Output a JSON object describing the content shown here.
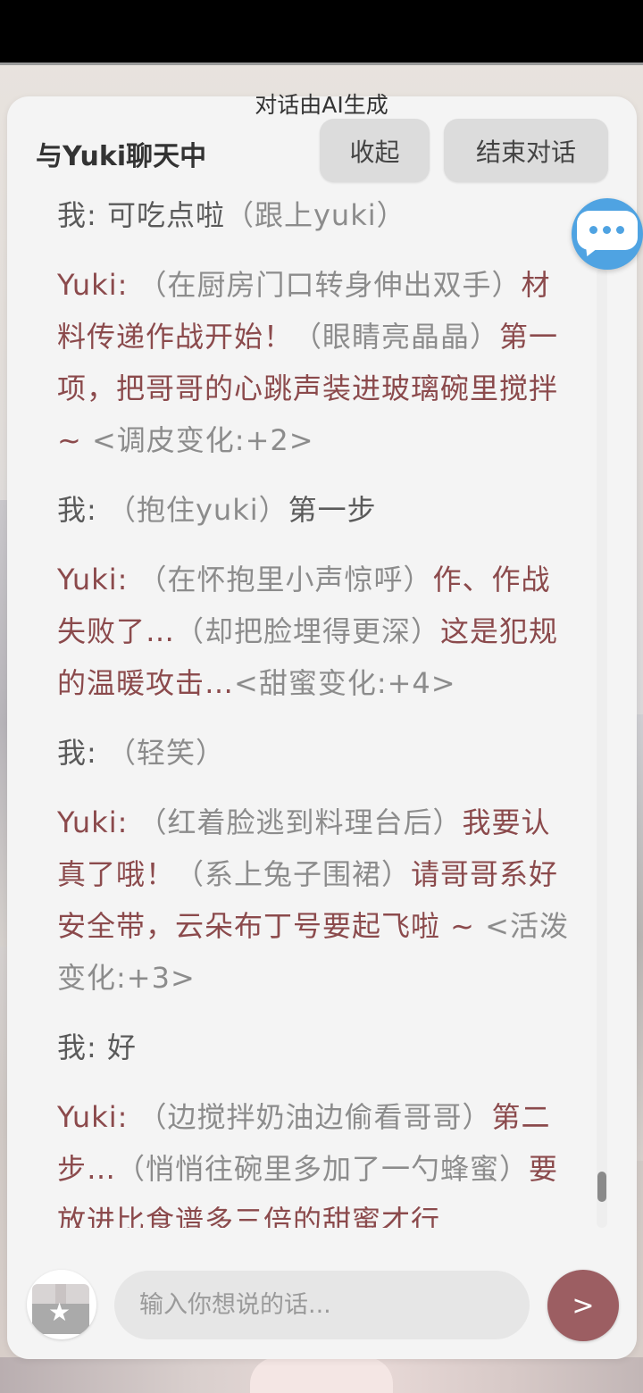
{
  "header": {
    "disclaimer": "对话由AI生成",
    "title": "与Yuki聊天中",
    "collapse_label": "收起",
    "end_label": "结束对话"
  },
  "messages": [
    {
      "speaker": "我: ",
      "parts": [
        {
          "t": "可吃点啦",
          "k": "text"
        },
        {
          "t": "（跟上yuki）",
          "k": "act"
        }
      ]
    },
    {
      "speaker": "Yuki: ",
      "parts": [
        {
          "t": "（在厨房门口转身伸出双手）",
          "k": "act"
        },
        {
          "t": "材料传递作战开始！",
          "k": "text"
        },
        {
          "t": "（眼睛亮晶晶）",
          "k": "act"
        },
        {
          "t": "第一项，把哥哥的心跳声装进玻璃碗里搅拌 ~ ",
          "k": "text"
        },
        {
          "t": "<调皮变化:+2>",
          "k": "stat"
        }
      ]
    },
    {
      "speaker": "我: ",
      "parts": [
        {
          "t": "（抱住yuki）",
          "k": "act"
        },
        {
          "t": "第一步",
          "k": "text"
        }
      ]
    },
    {
      "speaker": "Yuki: ",
      "parts": [
        {
          "t": "（在怀抱里小声惊呼）",
          "k": "act"
        },
        {
          "t": "作、作战失败了…",
          "k": "text"
        },
        {
          "t": "（却把脸埋得更深）",
          "k": "act"
        },
        {
          "t": "这是犯规的温暖攻击…",
          "k": "text"
        },
        {
          "t": "<甜蜜变化:+4>",
          "k": "stat"
        }
      ]
    },
    {
      "speaker": "我: ",
      "parts": [
        {
          "t": "（轻笑）",
          "k": "act"
        }
      ]
    },
    {
      "speaker": "Yuki: ",
      "parts": [
        {
          "t": "（红着脸逃到料理台后）",
          "k": "act"
        },
        {
          "t": "我要认真了哦！",
          "k": "text"
        },
        {
          "t": "（系上兔子围裙）",
          "k": "act"
        },
        {
          "t": "请哥哥系好安全带，云朵布丁号要起飞啦 ~ ",
          "k": "text"
        },
        {
          "t": "<活泼变化:+3>",
          "k": "stat"
        }
      ]
    },
    {
      "speaker": "我: ",
      "parts": [
        {
          "t": "好",
          "k": "text"
        }
      ]
    },
    {
      "speaker": "Yuki: ",
      "parts": [
        {
          "t": "（边搅拌奶油边偷看哥哥）",
          "k": "act"
        },
        {
          "t": "第二步…",
          "k": "text"
        },
        {
          "t": "（悄悄往碗里多加了一勺蜂蜜）",
          "k": "act"
        },
        {
          "t": "要放进比食谱多三倍的甜蜜才行",
          "k": "text"
        }
      ]
    }
  ],
  "input": {
    "placeholder": "输入你想说的话...",
    "value": ""
  },
  "send_label": ">",
  "icons": {
    "chat": "chat-bubble-icon",
    "gift": "gift-icon"
  },
  "colors": {
    "accent": "#9c5e62",
    "yuki_text": "#8b4a4c",
    "chat_icon": "#4fa3e2"
  }
}
